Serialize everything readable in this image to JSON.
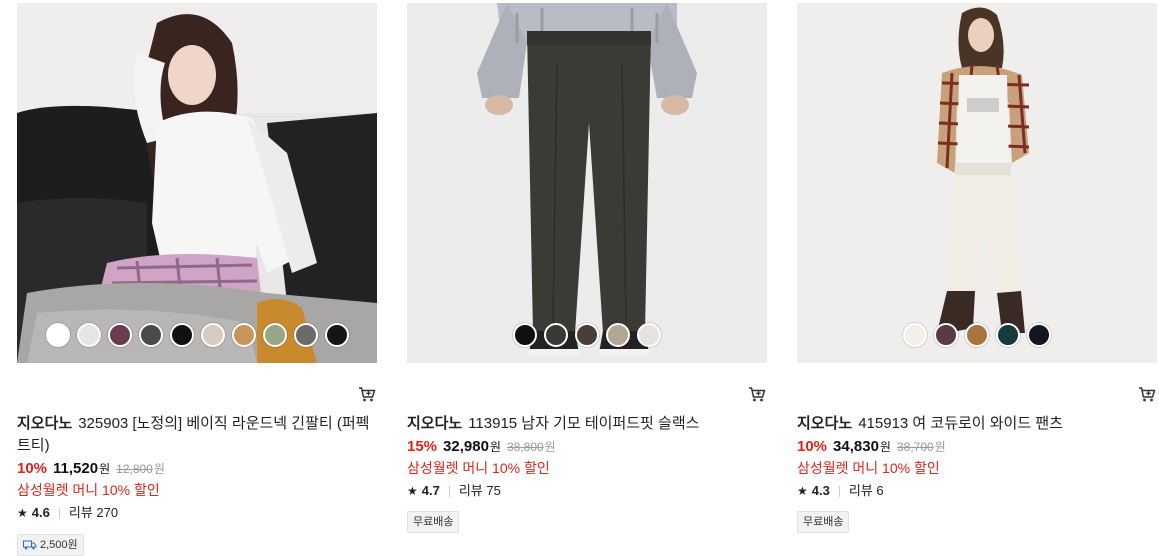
{
  "products": [
    {
      "brand": "지오다노",
      "name": "325903 [노정의] 베이직 라운드넥 긴팔티 (퍼펙트티)",
      "discount": "10%",
      "price": "11,520",
      "currency": "원",
      "original_price": "12,800",
      "promo": "삼성월렛 머니 10% 할인",
      "rating": "4.6",
      "review_label": "리뷰 270",
      "badge": "2,500원",
      "badge_icon": "truck-icon",
      "swatch_colors": [
        "#ffffff",
        "#e6e6e6",
        "#6b3b4e",
        "#4a4a4a",
        "#111111",
        "#d8ccc0",
        "#c8955a",
        "#9aa487",
        "#6b6b6b",
        "#151515"
      ]
    },
    {
      "brand": "지오다노",
      "name": "113915 남자 기모 테이퍼드핏 슬랙스",
      "discount": "15%",
      "price": "32,980",
      "currency": "원",
      "original_price": "38,800",
      "promo": "삼성월렛 머니 10% 할인",
      "rating": "4.7",
      "review_label": "리뷰 75",
      "badge": "무료배송",
      "swatch_colors": [
        "#111111",
        "#3a3833",
        "#4a3f38",
        "#b5a593",
        "#e7e4e0"
      ]
    },
    {
      "brand": "지오다노",
      "name": "415913 여 코듀로이 와이드 팬츠",
      "discount": "10%",
      "price": "34,830",
      "currency": "원",
      "original_price": "38,700",
      "promo": "삼성월렛 머니 10% 할인",
      "rating": "4.3",
      "review_label": "리뷰 6",
      "badge": "무료배송",
      "swatch_colors": [
        "#f3f0ea",
        "#5a3a45",
        "#a8753f",
        "#173a3a",
        "#111820"
      ]
    }
  ]
}
